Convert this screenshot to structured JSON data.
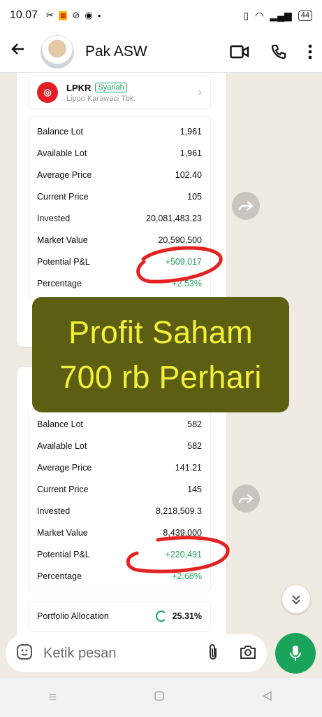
{
  "status_bar": {
    "time": "10.07",
    "battery": "44"
  },
  "header": {
    "contact_name": "Pak ASW"
  },
  "message1": {
    "stock": {
      "ticker": "LPKR",
      "tag": "Syariah",
      "company": "Lippo Karawaci Tbk."
    },
    "rows": [
      {
        "label": "Balance Lot",
        "value": "1,961"
      },
      {
        "label": "Available Lot",
        "value": "1,961"
      },
      {
        "label": "Average Price",
        "value": "102.40"
      },
      {
        "label": "Current Price",
        "value": "105"
      },
      {
        "label": "Invested",
        "value": "20,081,483.23"
      },
      {
        "label": "Market Value",
        "value": "20,590,500"
      },
      {
        "label": "Potential P&L",
        "value": "+509,017"
      },
      {
        "label": "Percentage",
        "value": "+2.53%"
      }
    ]
  },
  "overlay": {
    "line1": "Profit Saham",
    "line2": "700 rb Perhari"
  },
  "message2": {
    "rows": [
      {
        "label": "Balance Lot",
        "value": "582"
      },
      {
        "label": "Available Lot",
        "value": "582"
      },
      {
        "label": "Average Price",
        "value": "141.21"
      },
      {
        "label": "Current Price",
        "value": "145"
      },
      {
        "label": "Invested",
        "value": "8,218,509.3"
      },
      {
        "label": "Market Value",
        "value": "8,439,000"
      },
      {
        "label": "Potential P&L",
        "value": "+220,491"
      },
      {
        "label": "Percentage",
        "value": "+2.68%"
      }
    ],
    "allocation": {
      "label": "Portfolio Allocation",
      "value": "25.31%"
    }
  },
  "composer": {
    "placeholder": "Ketik pesan"
  },
  "colors": {
    "accent": "#1aa35a",
    "gain": "#1fa45b",
    "overlay_bg": "#5c5f12",
    "overlay_text": "#f3f03a",
    "annotation": "#e52222"
  }
}
